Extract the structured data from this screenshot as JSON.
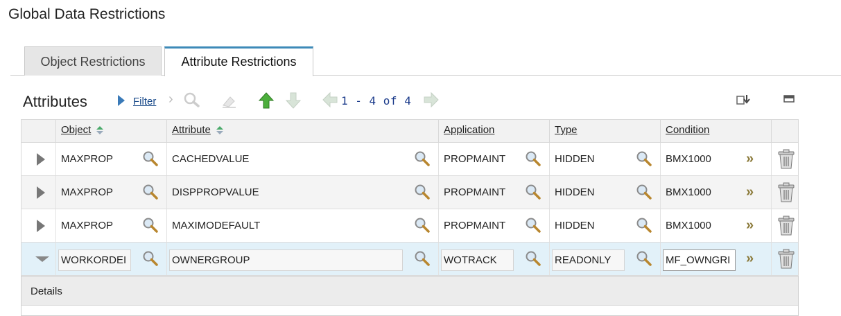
{
  "page": {
    "title": "Global Data Restrictions"
  },
  "tabs": [
    {
      "label": "Object Restrictions",
      "active": false
    },
    {
      "label": "Attribute Restrictions",
      "active": true
    }
  ],
  "toolbar": {
    "section_title": "Attributes",
    "filter_label": "Filter",
    "pager": "1 - 4 of 4"
  },
  "table": {
    "columns": [
      "Object",
      "Attribute",
      "Application",
      "Type",
      "Condition"
    ],
    "rows": [
      {
        "object": "MAXPROP",
        "attribute": "CACHEDVALUE",
        "application": "PROPMAINT",
        "type": "HIDDEN",
        "condition": "BMX1000"
      },
      {
        "object": "MAXPROP",
        "attribute": "DISPPROPVALUE",
        "application": "PROPMAINT",
        "type": "HIDDEN",
        "condition": "BMX1000"
      },
      {
        "object": "MAXPROP",
        "attribute": "MAXIMODEFAULT",
        "application": "PROPMAINT",
        "type": "HIDDEN",
        "condition": "BMX1000"
      },
      {
        "object": "WORKORDEI",
        "attribute": "OWNERGROUP",
        "application": "WOTRACK",
        "type": "READONLY",
        "condition": "MF_OWNGRI"
      }
    ]
  },
  "details": {
    "label": "Details"
  },
  "colors": {
    "accent": "#3d8ab8",
    "selected_row": "#e2f1f9",
    "link": "#1a4a8a"
  }
}
